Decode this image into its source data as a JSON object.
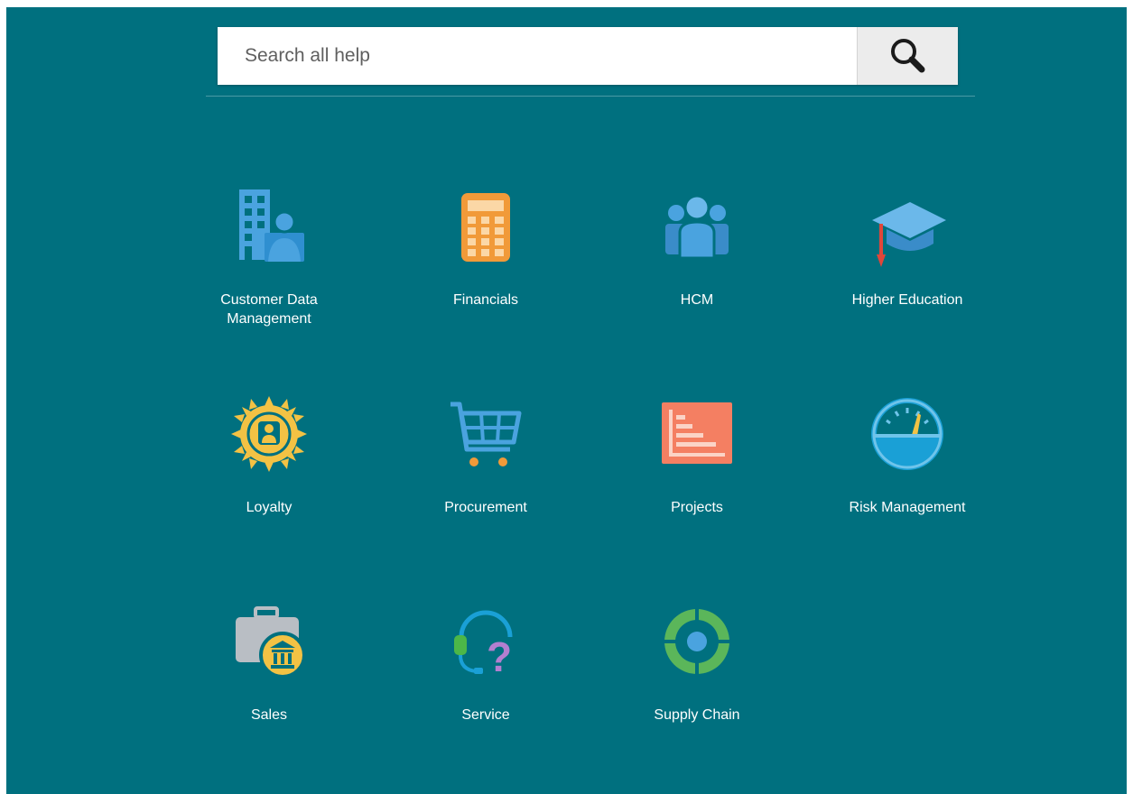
{
  "search": {
    "placeholder": "Search all help",
    "button_icon": "search-icon"
  },
  "tiles": [
    {
      "label": "Customer Data\nManagement",
      "icon": "building-person-icon"
    },
    {
      "label": "Financials",
      "icon": "calculator-icon"
    },
    {
      "label": "HCM",
      "icon": "people-group-icon"
    },
    {
      "label": "Higher Education",
      "icon": "graduation-cap-icon"
    },
    {
      "label": "Loyalty",
      "icon": "badge-person-icon"
    },
    {
      "label": "Procurement",
      "icon": "shopping-cart-icon"
    },
    {
      "label": "Projects",
      "icon": "gantt-chart-icon"
    },
    {
      "label": "Risk Management",
      "icon": "gauge-icon"
    },
    {
      "label": "Sales",
      "icon": "briefcase-bank-icon"
    },
    {
      "label": "Service",
      "icon": "headset-question-icon"
    },
    {
      "label": "Supply Chain",
      "icon": "cycle-arrows-icon"
    }
  ],
  "colors": {
    "background": "#00707f",
    "blue": "#4aa3df",
    "orange": "#f19a39",
    "yellow": "#f3c244",
    "salmon": "#f47f62",
    "green": "#5bb65a"
  }
}
